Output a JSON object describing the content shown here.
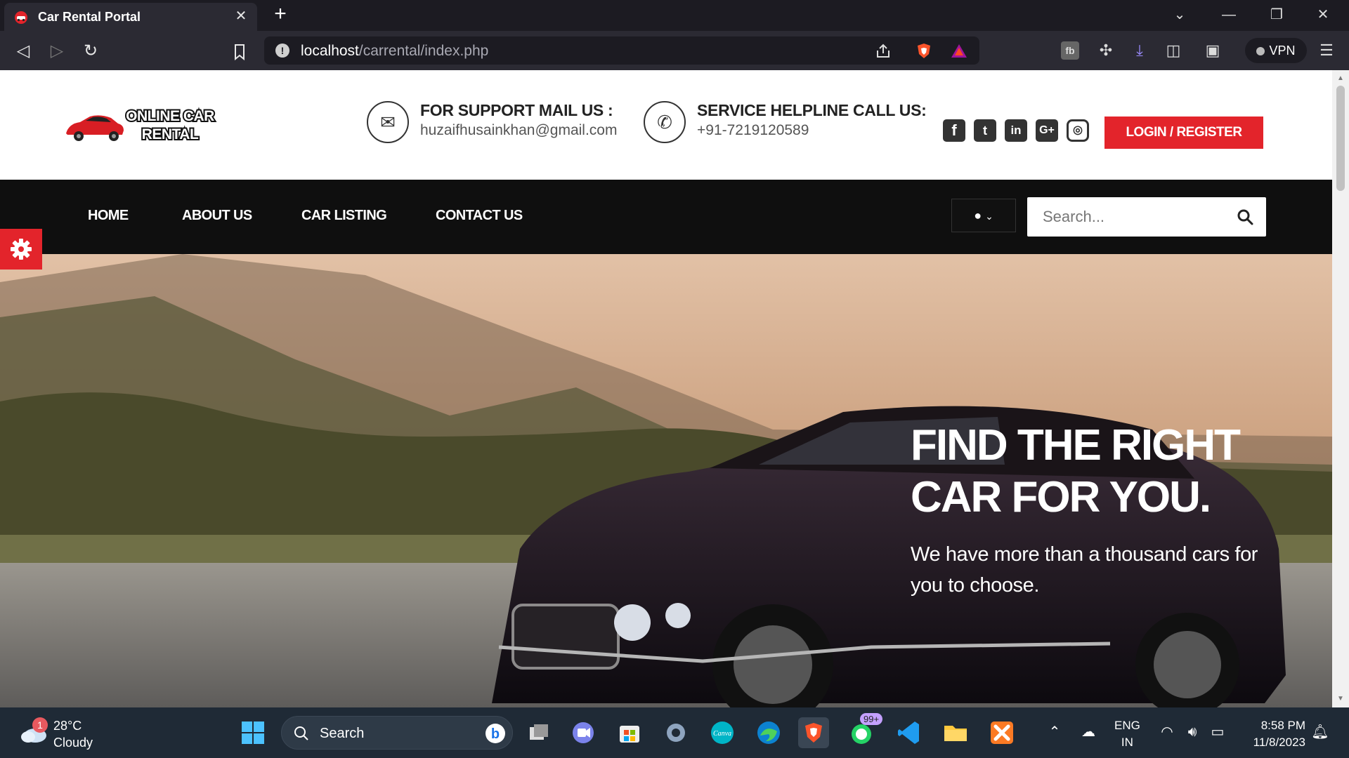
{
  "browser": {
    "tab_title": "Car Rental Portal",
    "url_host": "localhost",
    "url_path": "/carrental/index.php",
    "vpn_label": "VPN"
  },
  "header": {
    "logo_alt": "ONLINE CAR RENTAL",
    "mail_title": "FOR SUPPORT MAIL US :",
    "mail_value": "huzaifhusainkhan@gmail.com",
    "phone_title": "SERVICE HELPLINE CALL US:",
    "phone_value": "+91-7219120589",
    "login_label": "LOGIN / REGISTER",
    "social": [
      "facebook-icon",
      "twitter-icon",
      "linkedin-icon",
      "google-plus-icon",
      "instagram-icon"
    ]
  },
  "nav": {
    "items": [
      "HOME",
      "ABOUT US",
      "CAR LISTING",
      "CONTACT US"
    ],
    "search_placeholder": "Search..."
  },
  "hero": {
    "title": "FIND THE RIGHT CAR FOR YOU.",
    "subtitle": "We have more than a thousand cars for you to choose."
  },
  "taskbar": {
    "weather_badge": "1",
    "weather_temp": "28°C",
    "weather_desc": "Cloudy",
    "search_label": "Search",
    "whatsapp_badge": "99+",
    "lang_line1": "ENG",
    "lang_line2": "IN",
    "time": "8:58 PM",
    "date": "11/8/2023"
  },
  "colors": {
    "accent_red": "#e3242b",
    "nav_bg": "#0f0f0f",
    "browser_bg": "#2b2a33",
    "taskbar_bg": "#1f2a36"
  }
}
